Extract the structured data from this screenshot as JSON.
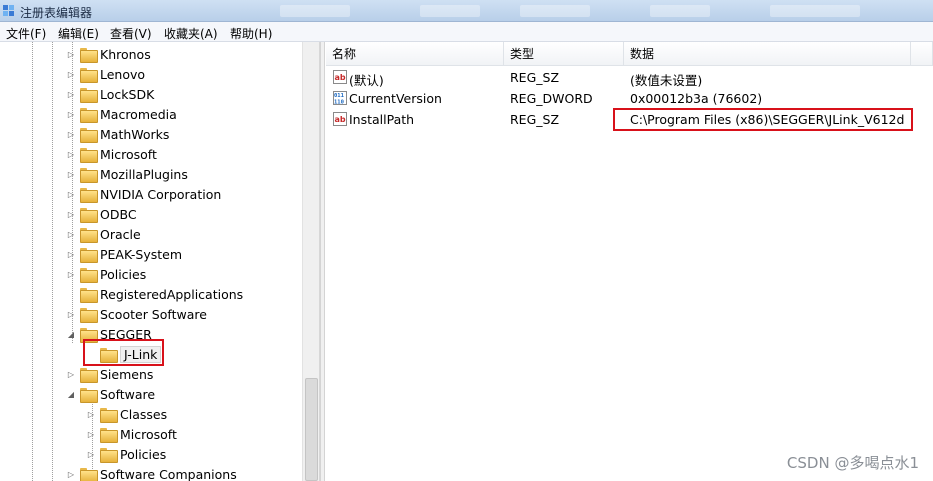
{
  "window": {
    "title": "注册表编辑器"
  },
  "menu": [
    {
      "label": "文件(F)"
    },
    {
      "label": "编辑(E)"
    },
    {
      "label": "查看(V)"
    },
    {
      "label": "收藏夹(A)"
    },
    {
      "label": "帮助(H)"
    }
  ],
  "tree": {
    "items": [
      {
        "label": "Khronos",
        "expander": "▷"
      },
      {
        "label": "Lenovo",
        "expander": "▷"
      },
      {
        "label": "LockSDK",
        "expander": "▷"
      },
      {
        "label": "Macromedia",
        "expander": "▷"
      },
      {
        "label": "MathWorks",
        "expander": "▷"
      },
      {
        "label": "Microsoft",
        "expander": "▷"
      },
      {
        "label": "MozillaPlugins",
        "expander": "▷"
      },
      {
        "label": "NVIDIA Corporation",
        "expander": "▷"
      },
      {
        "label": "ODBC",
        "expander": "▷"
      },
      {
        "label": "Oracle",
        "expander": "▷"
      },
      {
        "label": "PEAK-System",
        "expander": "▷"
      },
      {
        "label": "Policies",
        "expander": "▷"
      },
      {
        "label": "RegisteredApplications",
        "expander": ""
      },
      {
        "label": "Scooter Software",
        "expander": "▷"
      },
      {
        "label": "SEGGER",
        "expander": "◢"
      },
      {
        "label": "J-Link",
        "expander": ""
      },
      {
        "label": "Siemens",
        "expander": "▷"
      },
      {
        "label": "Software",
        "expander": "◢"
      },
      {
        "label": "Classes",
        "expander": "▷"
      },
      {
        "label": "Microsoft",
        "expander": "▷"
      },
      {
        "label": "Policies",
        "expander": "▷"
      },
      {
        "label": "Software Companions",
        "expander": "▷"
      }
    ]
  },
  "values": {
    "headers": {
      "name": "名称",
      "type": "类型",
      "data": "数据"
    },
    "rows": [
      {
        "icon": "string-value-icon",
        "name": "(默认)",
        "type": "REG_SZ",
        "data": "(数值未设置)"
      },
      {
        "icon": "dword-value-icon",
        "name": "CurrentVersion",
        "type": "REG_DWORD",
        "data": "0x00012b3a (76602)"
      },
      {
        "icon": "string-value-icon",
        "name": "InstallPath",
        "type": "REG_SZ",
        "data": "C:\\Program Files (x86)\\SEGGER\\JLink_V612d"
      }
    ]
  },
  "watermark": "CSDN @多喝点水1",
  "colors": {
    "highlight": "#d8111a"
  }
}
